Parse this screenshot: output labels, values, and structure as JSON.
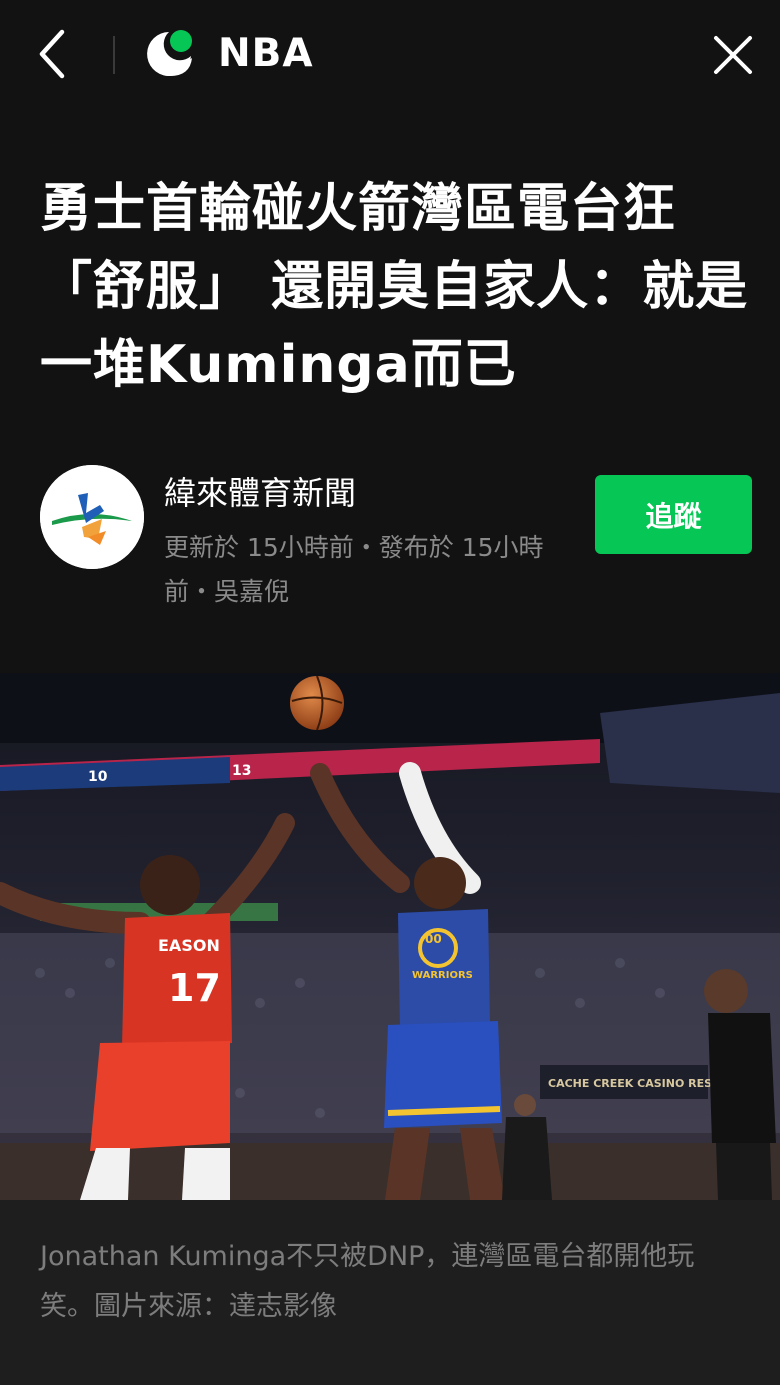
{
  "header": {
    "section_title": "NBA",
    "back_icon": "chevron-left-icon",
    "close_icon": "close-icon",
    "logo_icon": "line-today-logo-icon",
    "logo_color": "#06c755"
  },
  "article": {
    "headline": "勇士首輪碰火箭灣區電台狂「舒服」 還開臭自家人：就是一堆Kuminga而已"
  },
  "publisher": {
    "name": "緯來體育新聞",
    "meta": "更新於 15小時前・發布於 15小時前・吳嘉倪",
    "follow_label": "追蹤",
    "follow_color": "#06c755"
  },
  "photo": {
    "description_icon": "basketball-game-photo",
    "jersey_red_name": "EASON",
    "jersey_red_number": "17",
    "jersey_blue_number": "00",
    "jersey_blue_team": "WARRIORS",
    "banner_text": "CACHE CREEK CASINO RESORT",
    "score_left": "10",
    "score_right": "13"
  },
  "caption": {
    "text": "Jonathan Kuminga不只被DNP，連灣區電台都開他玩笑。圖片來源：達志影像"
  }
}
